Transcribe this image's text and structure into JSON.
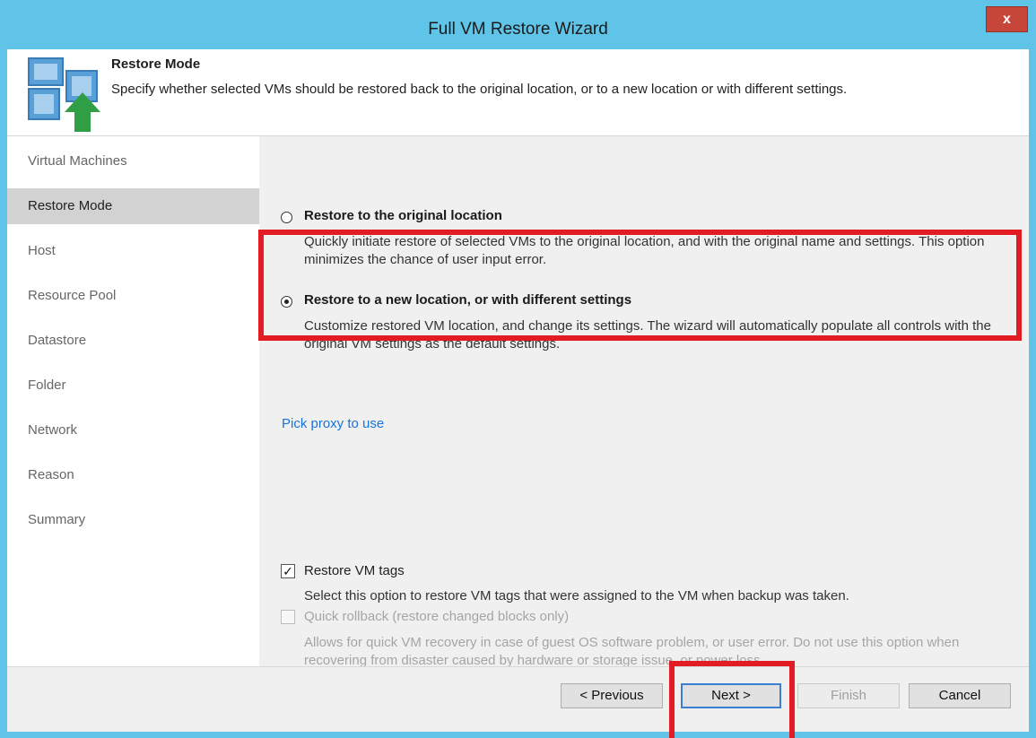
{
  "window": {
    "title": "Full VM Restore Wizard",
    "close_glyph": "x"
  },
  "header": {
    "title": "Restore Mode",
    "description": "Specify whether selected VMs should be restored back to the original location, or to a new location or with different settings.",
    "icon": "restore-vm-icon"
  },
  "sidebar": {
    "items": [
      {
        "label": "Virtual Machines"
      },
      {
        "label": "Restore Mode"
      },
      {
        "label": "Host"
      },
      {
        "label": "Resource Pool"
      },
      {
        "label": "Datastore"
      },
      {
        "label": "Folder"
      },
      {
        "label": "Network"
      },
      {
        "label": "Reason"
      },
      {
        "label": "Summary"
      }
    ],
    "active": "Restore Mode"
  },
  "options": [
    {
      "label": "Restore to the original location",
      "description": "Quickly initiate restore of selected VMs to the original location, and with the original name and settings. This option minimizes the chance of user input error.",
      "selected": false
    },
    {
      "label": "Restore to a new location, or with different settings",
      "description": "Customize restored VM location, and change its settings. The wizard will automatically populate all controls with the original VM settings as the default settings.",
      "selected": true
    }
  ],
  "link": {
    "label": "Pick proxy to use"
  },
  "restore_tags": {
    "label": "Restore VM tags",
    "description": "Select this option to restore VM tags that were assigned to the VM when backup was taken.",
    "checked": true
  },
  "quick_rollback": {
    "label": "Quick rollback (restore changed blocks only)",
    "description": "Allows for quick VM recovery in case of guest OS software problem, or user error. Do not use this option when recovering from disaster caused by hardware or storage issue, or power loss.",
    "checked": false,
    "enabled": false
  },
  "footer": {
    "previous": "< Previous",
    "next": "Next >",
    "finish": "Finish",
    "cancel": "Cancel"
  },
  "colors": {
    "accent": "#5fc4e8",
    "annotation": "#e31c23",
    "link": "#1a73d6"
  }
}
